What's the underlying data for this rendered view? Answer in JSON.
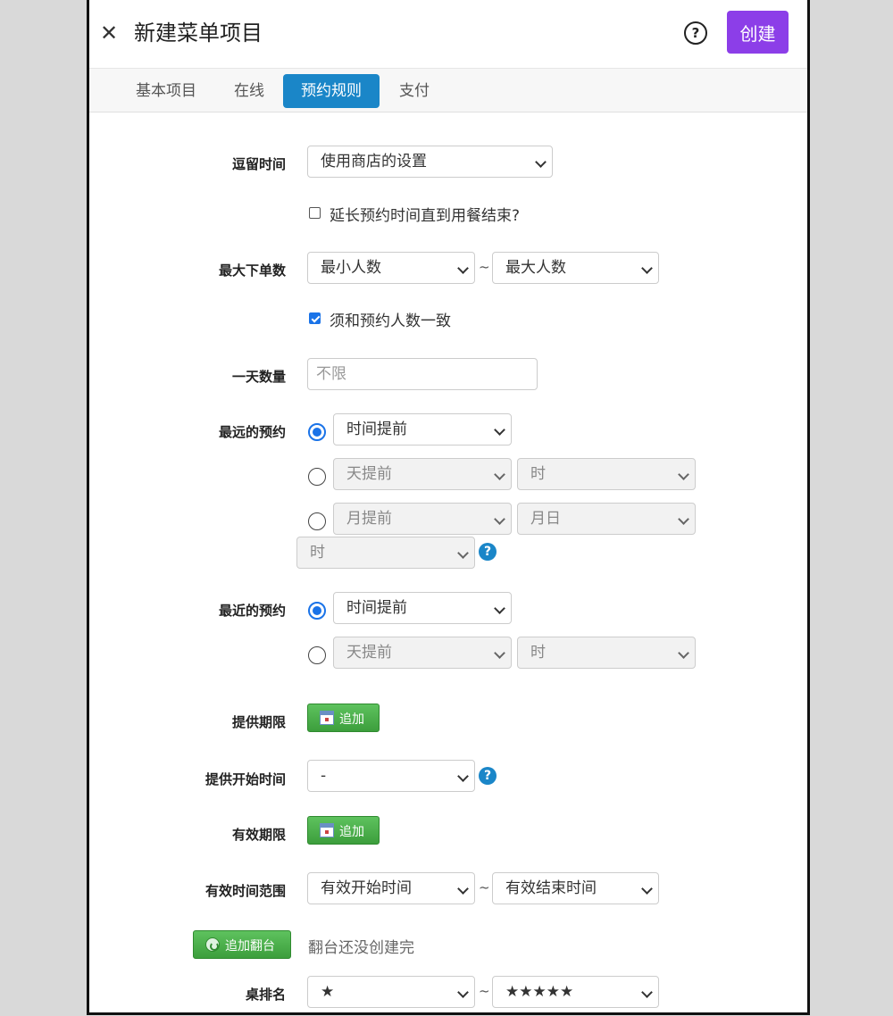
{
  "header": {
    "title": "新建菜单项目",
    "create_label": "创建"
  },
  "tabs": [
    {
      "label": "基本项目",
      "active": false
    },
    {
      "label": "在线",
      "active": false
    },
    {
      "label": "预约规则",
      "active": true
    },
    {
      "label": "支付",
      "active": false
    }
  ],
  "form": {
    "stay_time": {
      "label": "逗留时间",
      "value": "使用商店的设置"
    },
    "extend_checkbox": {
      "label": "延长预约时间直到用餐结束?",
      "checked": false
    },
    "max_orders": {
      "label": "最大下单数",
      "min_value": "最小人数",
      "separator": "~",
      "max_value": "最大人数"
    },
    "match_checkbox": {
      "label": "须和预约人数一致",
      "checked": true
    },
    "daily_quantity": {
      "label": "一天数量",
      "placeholder": "不限"
    },
    "farthest": {
      "label": "最远的预约",
      "option1": {
        "value": "时间提前",
        "selected": true
      },
      "option2": {
        "value": "天提前",
        "hour": "时",
        "selected": false
      },
      "option3": {
        "value": "月提前",
        "day": "月日",
        "hour": "时",
        "selected": false
      }
    },
    "nearest": {
      "label": "最近的预约",
      "option1": {
        "value": "时间提前",
        "selected": true
      },
      "option2": {
        "value": "天提前",
        "hour": "时",
        "selected": false
      }
    },
    "offer_period": {
      "label": "提供期限",
      "button": "追加"
    },
    "offer_start": {
      "label": "提供开始时间",
      "value": "-"
    },
    "valid_period": {
      "label": "有效期限",
      "button": "追加"
    },
    "valid_range": {
      "label": "有效时间范围",
      "start": "有效开始时间",
      "separator": "~",
      "end": "有效结束时间"
    },
    "turnover": {
      "button": "追加翻台",
      "note": "翻台还没创建完"
    },
    "table_rank": {
      "label": "桌排名",
      "min": "★",
      "separator": "~",
      "max": "★★★★★"
    }
  },
  "colors": {
    "accent": "#8c3ee8",
    "tab_active": "#1a86c8",
    "radio": "#1a73e8",
    "green": "#3c9e3c"
  }
}
